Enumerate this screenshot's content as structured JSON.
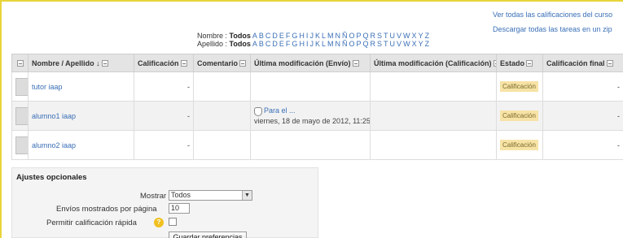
{
  "top_links": {
    "view_all": "Ver todas las calificaciones del curso",
    "download_all": "Descargar todas las tareas en un zip"
  },
  "filters": {
    "first_name_label": "Nombre : ",
    "last_name_label": "Apellido : ",
    "all_label": "Todos",
    "letters": [
      "A",
      "B",
      "C",
      "D",
      "E",
      "F",
      "G",
      "H",
      "I",
      "J",
      "K",
      "L",
      "M",
      "N",
      "Ñ",
      "O",
      "P",
      "Q",
      "R",
      "S",
      "T",
      "U",
      "V",
      "W",
      "X",
      "Y",
      "Z"
    ]
  },
  "table": {
    "headers": [
      "",
      "Nombre / Apellido ↓",
      "Calificación",
      "Comentario",
      "Última modificación (Envío)",
      "Última modificación (Calificación)",
      "Estado",
      "Calificación final"
    ],
    "rows": [
      {
        "name": "tutor iaap",
        "grade": "-",
        "submission_link": "",
        "submission_date": "",
        "status": "Calificación",
        "final": "-"
      },
      {
        "name": "alumno1 iaap",
        "grade": "-",
        "submission_link": "Para el ...",
        "submission_date": "viernes, 18 de mayo de 2012, 11:25",
        "status": "Calificación",
        "final": "-"
      },
      {
        "name": "alumno2 iaap",
        "grade": "-",
        "submission_link": "",
        "submission_date": "",
        "status": "Calificación",
        "final": "-"
      }
    ]
  },
  "options": {
    "title": "Ajustes opcionales",
    "show_label": "Mostrar",
    "show_value": "Todos",
    "per_page_label": "Envíos mostrados por página",
    "per_page_value": "10",
    "quick_grading_label": "Permitir calificación rápida",
    "save_button": "Guardar preferencias"
  },
  "colors": {
    "link": "#3a6fb7",
    "status_badge": "#f7e3a6",
    "accent_border": "#e8d43a"
  }
}
